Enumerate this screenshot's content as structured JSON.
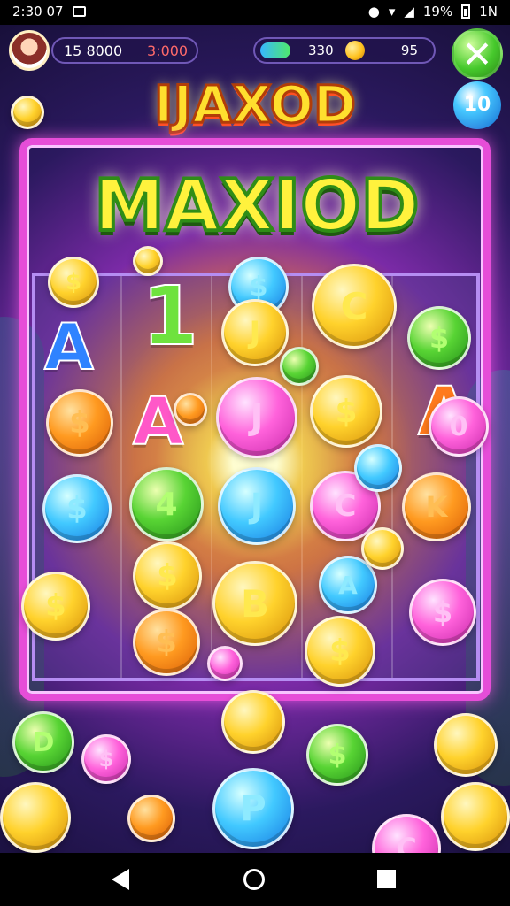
{
  "status": {
    "time": "2:30 07",
    "battery": "19%",
    "signal": "1N"
  },
  "hud": {
    "score": "15 8000",
    "bet": "3:000",
    "gems": "330",
    "coins": "95"
  },
  "buttons": {
    "close": "✕",
    "level": "10"
  },
  "titles": {
    "top": "IJAXOD",
    "main": "MAXIOD"
  },
  "board": {
    "letters": [
      "A",
      "1",
      "A",
      "A"
    ],
    "coins": [
      {
        "symbol": "$",
        "color": "gold"
      },
      {
        "symbol": "$",
        "color": "blue"
      },
      {
        "symbol": "C",
        "color": "gold"
      },
      {
        "symbol": "$",
        "color": "green"
      },
      {
        "symbol": "J",
        "color": "gold"
      },
      {
        "symbol": "$",
        "color": "orange"
      },
      {
        "symbol": "J",
        "color": "pink"
      },
      {
        "symbol": "$",
        "color": "gold"
      },
      {
        "symbol": "0",
        "color": "pink"
      },
      {
        "symbol": "$",
        "color": "blue"
      },
      {
        "symbol": "4",
        "color": "green"
      },
      {
        "symbol": "J",
        "color": "blue"
      },
      {
        "symbol": "C",
        "color": "pink"
      },
      {
        "symbol": "K",
        "color": "orange"
      },
      {
        "symbol": "$",
        "color": "gold"
      },
      {
        "symbol": "B",
        "color": "gold"
      },
      {
        "symbol": "A",
        "color": "blue"
      },
      {
        "symbol": "$",
        "color": "gold"
      },
      {
        "symbol": "$",
        "color": "orange"
      },
      {
        "symbol": "$",
        "color": "gold"
      },
      {
        "symbol": "$",
        "color": "pink"
      },
      {
        "symbol": "D",
        "color": "green"
      },
      {
        "symbol": "$",
        "color": "pink"
      },
      {
        "symbol": "$",
        "color": "green"
      },
      {
        "symbol": "P",
        "color": "blue"
      },
      {
        "symbol": "C",
        "color": "pink"
      }
    ]
  },
  "nav": {
    "back": "",
    "home": "",
    "recents": ""
  }
}
